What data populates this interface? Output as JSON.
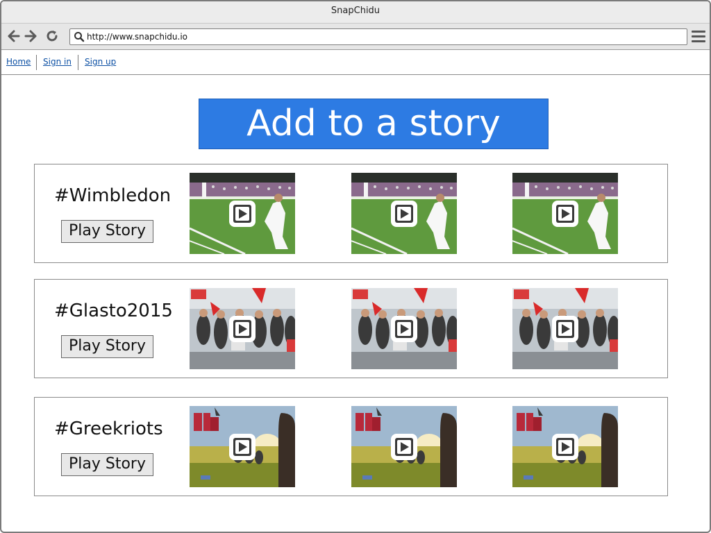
{
  "window": {
    "title": "SnapChidu"
  },
  "browser": {
    "url": "http://www.snapchidu.io"
  },
  "nav": {
    "home": "Home",
    "sign_in": "Sign in",
    "sign_up": "Sign up"
  },
  "main": {
    "add_button_label": "Add to a story"
  },
  "stories": [
    {
      "title": "#Wimbledon",
      "play_label": "Play Story"
    },
    {
      "title": "#Glasto2015",
      "play_label": "Play Story"
    },
    {
      "title": "#Greekriots",
      "play_label": "Play Story"
    }
  ],
  "colors": {
    "accent": "#2d7be3",
    "link": "#0b4fa3"
  },
  "icons": [
    "back-arrow-icon",
    "forward-arrow-icon",
    "reload-icon",
    "search-icon",
    "menu-icon",
    "play-icon"
  ]
}
